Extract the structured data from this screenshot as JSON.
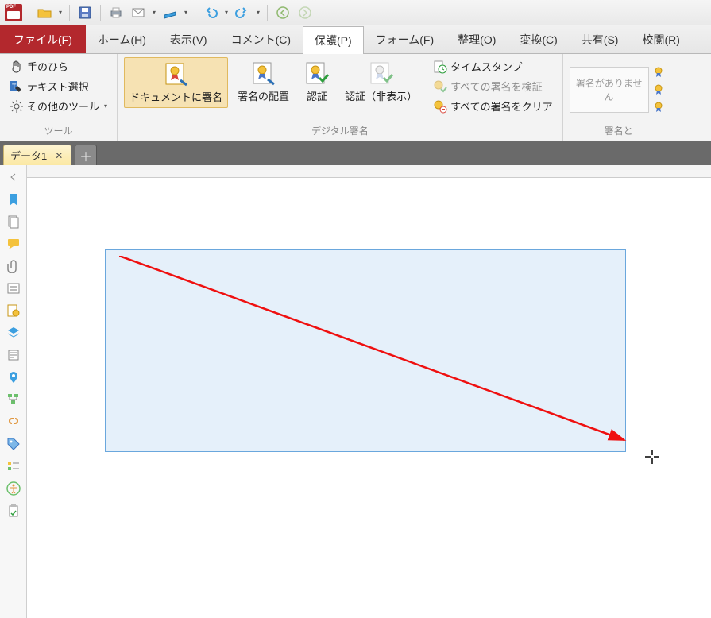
{
  "qat": {
    "undo_tip": "元に戻す",
    "redo_tip": "やり直し"
  },
  "tabs": {
    "file": "ファイル(F)",
    "home": "ホーム(H)",
    "view": "表示(V)",
    "comment": "コメント(C)",
    "protect": "保護(P)",
    "form": "フォーム(F)",
    "organize": "整理(O)",
    "convert": "変換(C)",
    "share": "共有(S)",
    "review": "校閲(R)"
  },
  "ribbon": {
    "tools_group": "ツール",
    "hand": "手のひら",
    "text_select": "テキスト選択",
    "other_tools": "その他のツール",
    "sign_doc": "ドキュメントに署名",
    "place_sig": "署名の配置",
    "certify": "認証",
    "certify_hidden": "認証（非表示）",
    "digital_sig_group": "デジタル署名",
    "timestamp": "タイムスタンプ",
    "verify_all": "すべての署名を検証",
    "clear_all": "すべての署名をクリア",
    "no_sig": "署名がありません",
    "sig_group_right": "署名と"
  },
  "doc": {
    "tab_name": "データ1"
  }
}
